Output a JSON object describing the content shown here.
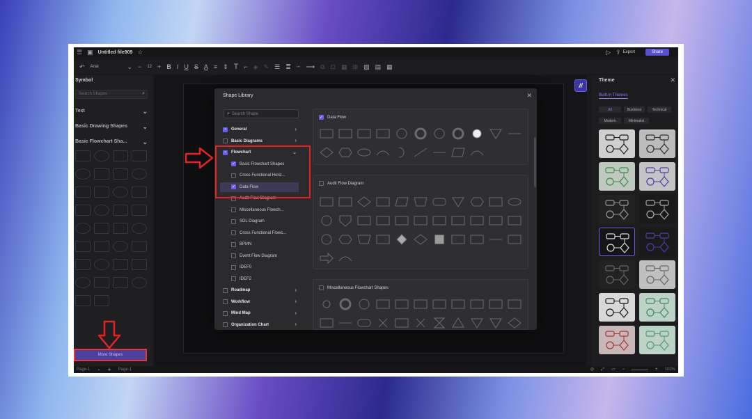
{
  "app": {
    "title": "Untitled file909",
    "export_label": "Export",
    "share_label": "Share"
  },
  "toolbar": {
    "font": "Arial",
    "font_size": "12",
    "bold": "B",
    "italic": "I",
    "underline": "U",
    "text_tool": "T"
  },
  "left_panel": {
    "title": "Symbol",
    "search_placeholder": "Search Shapes",
    "sections": [
      "Text",
      "Basic Drawing Shapes",
      "Basic Flowchart Sha..."
    ],
    "more_shapes_label": "More Shapes"
  },
  "right_panel": {
    "title": "Theme",
    "tab": "Built-in Themes",
    "filters": [
      "All",
      "Business",
      "Technical",
      "Modern",
      "Minimalist"
    ]
  },
  "bottom_bar": {
    "page_label": "Page-1",
    "page_tab": "Page-1",
    "zoom": "100%"
  },
  "modal": {
    "title": "Shape Library",
    "search_placeholder": "Search Shape",
    "tree": [
      {
        "label": "General",
        "level": 0,
        "state": "minus",
        "chevron": "right"
      },
      {
        "label": "Basic Diagrams",
        "level": 0,
        "state": "off",
        "chevron": "right"
      },
      {
        "label": "Flowchart",
        "level": 0,
        "state": "minus",
        "chevron": "down"
      },
      {
        "label": "Basic Flowchart Shapes",
        "level": 1,
        "state": "on"
      },
      {
        "label": "Cross Functional Horiz...",
        "level": 1,
        "state": "off"
      },
      {
        "label": "Data Flow",
        "level": 1,
        "state": "on",
        "selected": true
      },
      {
        "label": "Audit Flow Diagram",
        "level": 1,
        "state": "off"
      },
      {
        "label": "Miscellaneous Flowch...",
        "level": 1,
        "state": "off"
      },
      {
        "label": "SDL Diagram",
        "level": 1,
        "state": "off"
      },
      {
        "label": "Cross Functional Flowc...",
        "level": 1,
        "state": "off"
      },
      {
        "label": "BPMN",
        "level": 1,
        "state": "off"
      },
      {
        "label": "Event Flow Diagram",
        "level": 1,
        "state": "off"
      },
      {
        "label": "IDEF0",
        "level": 1,
        "state": "off"
      },
      {
        "label": "IDEF2",
        "level": 1,
        "state": "off"
      },
      {
        "label": "Roadmap",
        "level": 0,
        "state": "off",
        "chevron": "right"
      },
      {
        "label": "Workflow",
        "level": 0,
        "state": "off",
        "chevron": "right"
      },
      {
        "label": "Mind Map",
        "level": 0,
        "state": "off",
        "chevron": "right"
      },
      {
        "label": "Organization Chart",
        "level": 0,
        "state": "off",
        "chevron": "right"
      }
    ],
    "panels": [
      {
        "title": "Data Flow",
        "checked": true
      },
      {
        "title": "Audit Flow Diagram",
        "checked": false
      },
      {
        "title": "Miscellaneous Flowchart Shapes",
        "checked": false
      }
    ]
  },
  "colors": {
    "accent": "#6a5cf0",
    "highlight": "#e32424"
  }
}
